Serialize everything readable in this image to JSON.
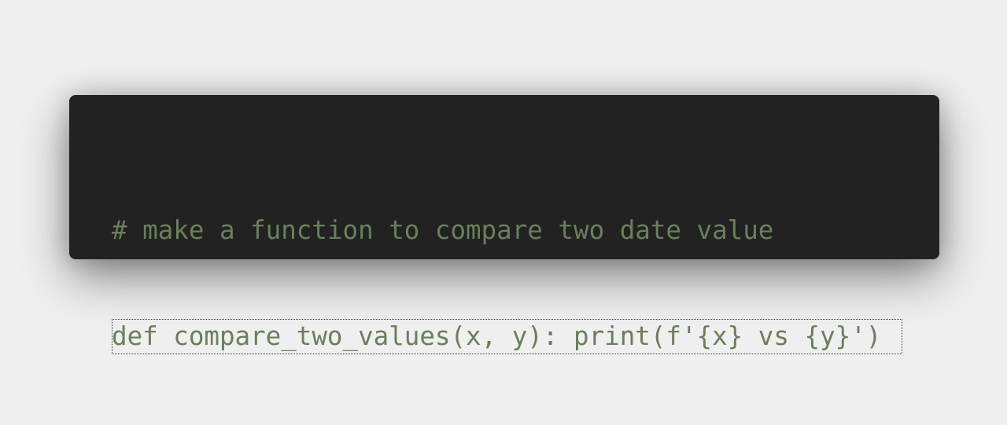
{
  "editor": {
    "lines": [
      "# make a function to compare two date value",
      "def compare_two_values(x, y): print(f'{x} vs {y}')"
    ]
  },
  "colors": {
    "page_background": "#efefef",
    "editor_background": "#222222",
    "code_text": "#6a7f5c"
  }
}
